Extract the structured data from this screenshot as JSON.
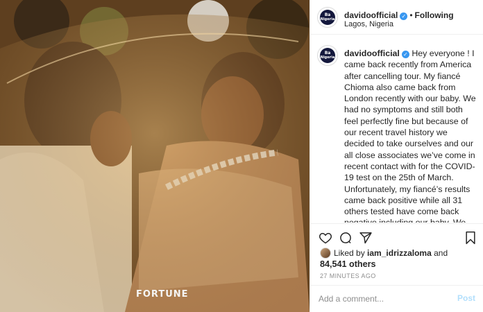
{
  "post": {
    "photo_alt": "Couple under a beaded veil",
    "watermark": "FORTUNE"
  },
  "header": {
    "username": "davidoofficial",
    "verified_icon": "verified-badge-icon",
    "separator": "•",
    "follow_label": "Following",
    "location": "Lagos, Nigeria",
    "avatar_text_line1": "Ba",
    "avatar_text_line2": "Nigeria"
  },
  "caption": {
    "username": "davidoofficial",
    "text": "Hey everyone ! I came back recently from America after cancelling tour. My fiancé Chioma also came back from London recently with our baby. We had no symptoms and still both feel perfectly fine but because of our recent travel history we decided to take ourselves and our all close associates we’ve come in recent contact with for the COVID-19 test on the 25th of March. Unfortunately, my fiancé’s results came back positive while all 31 others tested have come back negative including our baby. We are however doing perfectly fine and she is even still yet to show any symptoms whatsoever. She is now being quarantined and I"
  },
  "actions": {
    "like_icon": "heart-icon",
    "comment_icon": "comment-icon",
    "share_icon": "share-icon",
    "save_icon": "bookmark-icon"
  },
  "likes": {
    "prefix": "Liked by",
    "liker": "iam_idrizzaloma",
    "connector": "and",
    "count": "84,541 others"
  },
  "timestamp": "27 MINUTES AGO",
  "comment": {
    "placeholder": "Add a comment...",
    "post_label": "Post"
  },
  "colors": {
    "verified": "#3897f0",
    "post_disabled": "#b2dffc",
    "border": "#efefef",
    "muted": "#8e8e8e"
  }
}
